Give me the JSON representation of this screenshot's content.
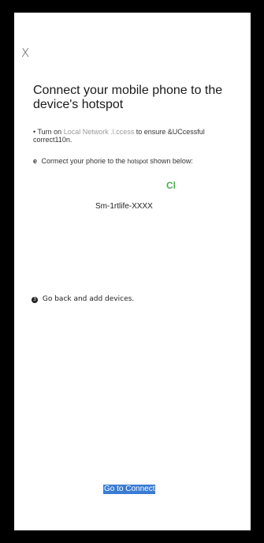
{
  "header": {
    "close_glyph": "X"
  },
  "title": "Connect your mobile phone to the device's hotspot",
  "steps": {
    "step1": {
      "bullet": "•",
      "prefix": "Turn on",
      "link": "Local Network .l.ccess",
      "suffix": "to ensure &UCcessful correct110n."
    },
    "step2": {
      "bullet": "e",
      "prefix": "Cormect your phorie to the",
      "link_small": "hotspot",
      "suffix": "shown below:"
    },
    "wifi_icon_text": "Cl",
    "ssid": "Sm-1rtlife-XXXX",
    "step3": {
      "number": "3",
      "text": "Go back and add devices."
    }
  },
  "footer": {
    "connect_label": "Go to Connect"
  },
  "colors": {
    "accent": "#3a7bd5",
    "wifi": "#4caf50",
    "frame": "#000000"
  }
}
